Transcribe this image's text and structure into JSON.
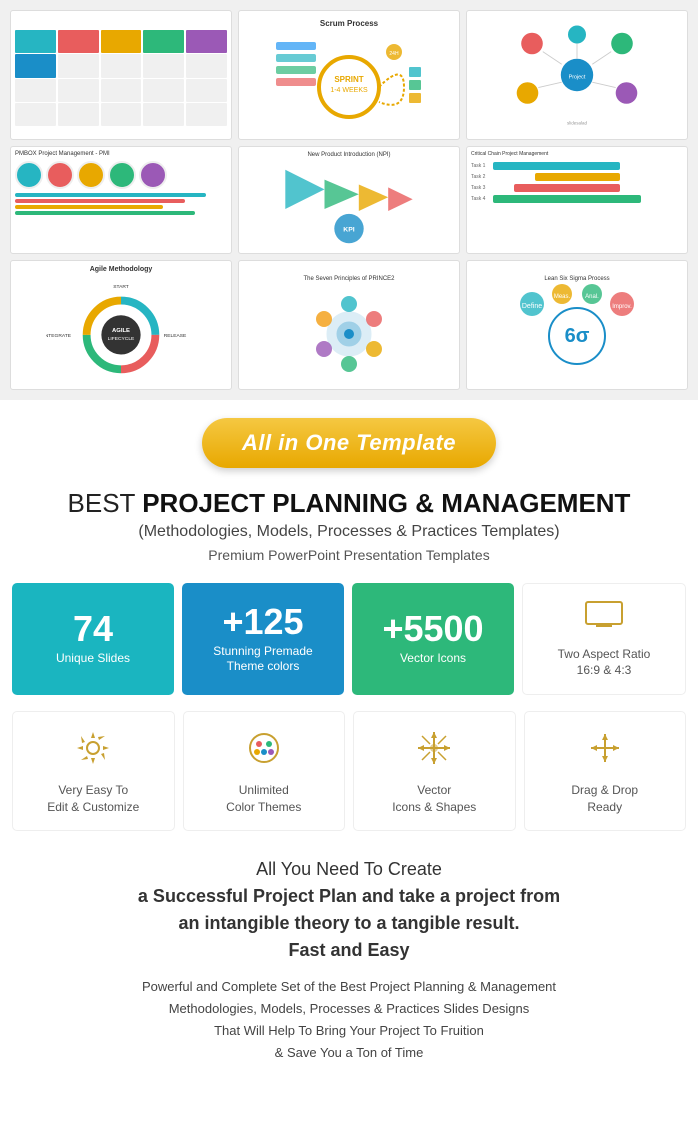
{
  "gallery": {
    "slides": [
      {
        "id": 1,
        "title": "",
        "type": "colorbar"
      },
      {
        "id": 2,
        "title": "Scrum Process",
        "type": "scrum"
      },
      {
        "id": 3,
        "title": "",
        "type": "mindmap"
      },
      {
        "id": 4,
        "title": "PMBOX Project Management - PMI",
        "type": "circles"
      },
      {
        "id": 5,
        "title": "New Product Introduction (NPI)",
        "type": "npi"
      },
      {
        "id": 6,
        "title": "Critical Chain Project Management (C...",
        "type": "gantt"
      },
      {
        "id": 7,
        "title": "Agile Methodology",
        "type": "agile"
      },
      {
        "id": 8,
        "title": "The Seven Principles of PRINCE2",
        "type": "prince2"
      },
      {
        "id": 9,
        "title": "Lean Six Sigma Process",
        "type": "sigma"
      }
    ]
  },
  "badge": {
    "label": "All in One Template"
  },
  "heading": {
    "line1_normal": "BEST ",
    "line1_bold": "PROJECT PLANNING & MANAGEMENT",
    "line2": "(Methodologies, Models, Processes & Practices Templates)",
    "line3": "Premium PowerPoint Presentation Templates"
  },
  "features_row1": [
    {
      "id": "unique-slides",
      "number": "74",
      "label": "Unique Slides",
      "color": "teal",
      "icon": null
    },
    {
      "id": "theme-colors",
      "number": "+125",
      "label": "Stunning Premade\nTheme colors",
      "color": "blue",
      "icon": null
    },
    {
      "id": "vector-icons",
      "number": "+5500",
      "label": "Vector Icons",
      "color": "green",
      "icon": null
    },
    {
      "id": "aspect-ratio",
      "number": null,
      "label": "Two Aspect Ratio\n16:9 & 4:3",
      "color": "white",
      "icon": "monitor"
    }
  ],
  "features_row2": [
    {
      "id": "edit-customize",
      "icon": "gear",
      "label": "Very Easy To\nEdit & Customize"
    },
    {
      "id": "color-themes",
      "icon": "palette",
      "label": "Unlimited\nColor Themes"
    },
    {
      "id": "vector-shapes",
      "icon": "shapes",
      "label": "Vector\nIcons & Shapes"
    },
    {
      "id": "drag-drop",
      "icon": "move",
      "label": "Drag & Drop\nReady"
    }
  ],
  "bottom": {
    "main_text": "All You Need To Create\na Successful Project Plan and take a project from\nan intangible theory to a tangible result.\nFast and Easy",
    "desc_text": "Powerful and Complete Set of the Best Project Planning & Management\nMethodologies, Models, Processes & Practices Slides Designs\nThat Will Help To Bring Your Project To Fruition\n& Save You a Ton of Time"
  }
}
